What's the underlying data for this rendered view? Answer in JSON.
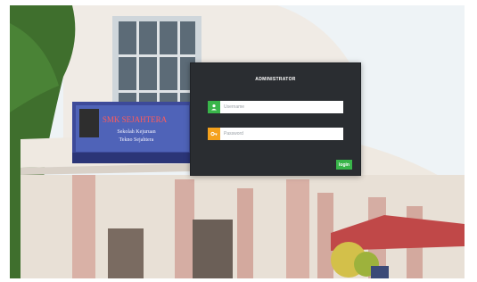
{
  "panel": {
    "title": "ADMINISTRATOR",
    "username": {
      "placeholder": "Username",
      "icon": "user-icon",
      "accent": "#39b54a"
    },
    "password": {
      "placeholder": "Password",
      "icon": "key-icon",
      "accent": "#f4a11d"
    },
    "login_label": "login",
    "login_color": "#39b54a"
  },
  "sign": {
    "line1": "SMK SEJAHTERA",
    "line2": "Sekolah Kejuruan",
    "line3": "Tekno Sejahtera"
  },
  "colors": {
    "panel_bg": "#2a2d31",
    "sky": "#eef3f6",
    "building": "#f1ebe3",
    "pillar": "#d9b1a6",
    "foliage": "#3f6f2d"
  }
}
